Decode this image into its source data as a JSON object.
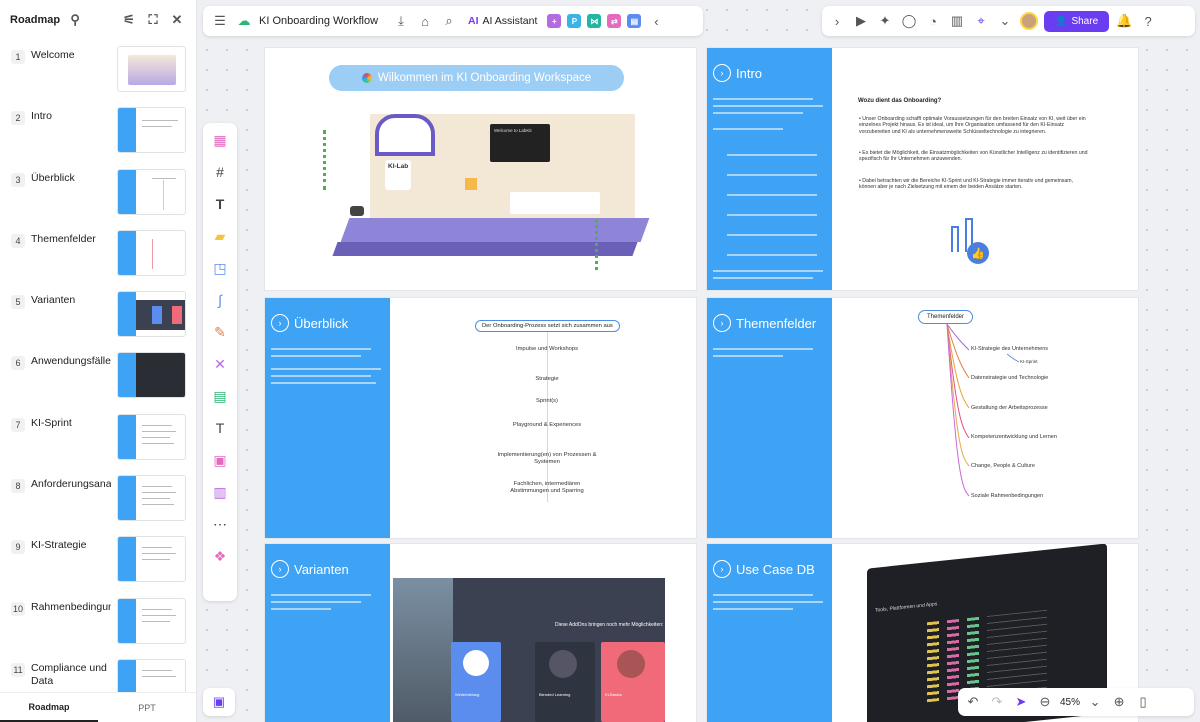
{
  "sidebar": {
    "title": "Roadmap",
    "items": [
      {
        "num": "1",
        "label": "Welcome"
      },
      {
        "num": "2",
        "label": "Intro"
      },
      {
        "num": "3",
        "label": "Überblick"
      },
      {
        "num": "4",
        "label": "Themenfelder"
      },
      {
        "num": "5",
        "label": "Varianten"
      },
      {
        "num": "6",
        "label": "Anwendungsfälle"
      },
      {
        "num": "7",
        "label": "KI-Sprint"
      },
      {
        "num": "8",
        "label": "Anforderungsana"
      },
      {
        "num": "9",
        "label": "KI-Strategie"
      },
      {
        "num": "10",
        "label": "Rahmenbedingun"
      },
      {
        "num": "11",
        "label": "Compliance und Data"
      }
    ],
    "footer": {
      "tab1": "Roadmap",
      "tab2": "PPT"
    }
  },
  "toolbar": {
    "doc_title": "KI Onboarding Workflow",
    "ai_label": "AI Assistant",
    "share_label": "Share"
  },
  "zoom": {
    "value": "45%"
  },
  "slides": {
    "welcome": {
      "banner": "Wilkommen im KI Onboarding Workspace",
      "screen_text": "Welcome to LabKit",
      "room_label": "KI-Lab"
    },
    "intro": {
      "heading": "Intro",
      "question": "Wozu dient das Onboarding?",
      "bullet1": "Unser Onboarding schafft optimale Voraussetzungen für den breiten Einsatz von KI, weit über ein einzelnes Projekt hinaus. Es ist ideal, um Ihre Organisation umfassend für den KI-Einsatz vorzubereiten und KI als unternehmensweite Schlüsseltechnologie zu integrieren.",
      "bullet2": "Es bietet die Möglichkeit, die Einsatzmöglichkeiten von Künstlicher Intelligenz zu identifizieren und spezifisch für Ihr Unternehmen anzuwenden.",
      "bullet3": "Dabei betrachten wir die Bereiche KI-Sprint und KI-Strategie immer iterativ und gemeinsam, können aber je nach Zielsetzung mit einem der beiden Ansätze starten."
    },
    "ueberblick": {
      "heading": "Überblick",
      "flow_title": "Der Onboarding-Prozess setzt sich zusammen aus",
      "steps": [
        "Impulse und Workshops",
        "Strategie",
        "Sprint(s)",
        "Playground & Experiences",
        "Implementierung(en) von Prozessen & Systemen",
        "Fachlichen, intermediären Abstimmungen und Sparring"
      ]
    },
    "themenfelder": {
      "heading": "Themenfelder",
      "root": "Themenfelder",
      "branches": [
        "KI-Strategie des Unternehmens",
        "KI-Sprint",
        "Datenstrategie und Technologie",
        "Gestaltung der Arbeitsprozesse",
        "Kompetenzentwicklung und Lernen",
        "Change, People & Culture",
        "Soziale Rahmenbedingungen"
      ]
    },
    "varianten": {
      "heading": "Varianten",
      "addons": "Diese AddOns bringen noch mehr Möglichkeiten:",
      "cards": [
        "Blended Learning",
        "KI-Basics",
        "Weiterbildung"
      ]
    },
    "usecase": {
      "heading": "Use Case DB",
      "app_title": "Tools, Plattformen und Apps"
    }
  }
}
